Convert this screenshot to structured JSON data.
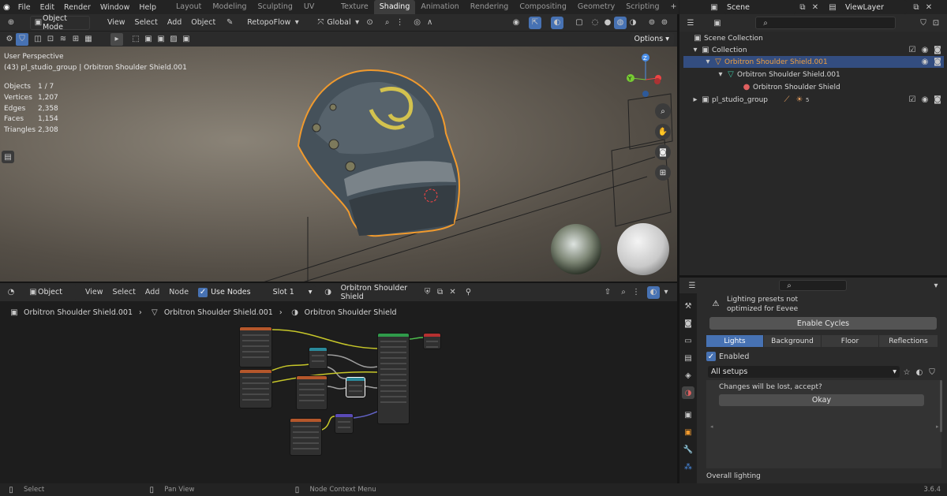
{
  "menu": [
    "File",
    "Edit",
    "Render",
    "Window",
    "Help"
  ],
  "workspaces": [
    "Layout",
    "Modeling",
    "Sculpting",
    "UV Editing",
    "Texture Paint",
    "Shading",
    "Animation",
    "Rendering",
    "Compositing",
    "Geometry Nodes",
    "Scripting"
  ],
  "active_workspace": "Shading",
  "scene": {
    "label": "Scene",
    "view_layer": "ViewLayer"
  },
  "viewport": {
    "mode": "Object Mode",
    "menus": [
      "View",
      "Select",
      "Add",
      "Object"
    ],
    "addon": "RetopoFlow",
    "orientation": "Global",
    "options": "Options",
    "perspective": "User Perspective",
    "context": "(43) pl_studio_group | Orbitron Shoulder Shield.001",
    "stats": [
      {
        "label": "Objects",
        "value": "1 / 7"
      },
      {
        "label": "Vertices",
        "value": "1,207"
      },
      {
        "label": "Edges",
        "value": "2,358"
      },
      {
        "label": "Faces",
        "value": "1,154"
      },
      {
        "label": "Triangles",
        "value": "2,308"
      }
    ],
    "gizmo": {
      "z": "Z",
      "y": "Y"
    }
  },
  "outliner": {
    "rows": [
      {
        "label": "Scene Collection"
      },
      {
        "label": "Collection"
      },
      {
        "label": "Orbitron Shoulder Shield.001"
      },
      {
        "label": "Orbitron Shoulder Shield.001"
      },
      {
        "label": "Orbitron Shoulder Shield"
      },
      {
        "label": "pl_studio_group",
        "badge": "5"
      }
    ]
  },
  "node_editor": {
    "type": "Object",
    "menus": [
      "View",
      "Select",
      "Add",
      "Node"
    ],
    "use_nodes": "Use Nodes",
    "slot": "Slot 1",
    "material": "Orbitron Shoulder Shield",
    "breadcrumb": [
      "Orbitron Shoulder Shield.001",
      "Orbitron Shoulder Shield.001",
      "Orbitron Shoulder Shield"
    ]
  },
  "properties": {
    "warning_line1": "Lighting presets not",
    "warning_line2": "optimized for Eevee",
    "enable_cycles": "Enable Cycles",
    "tabs": [
      "Lights",
      "Background",
      "Floor",
      "Reflections"
    ],
    "enabled": "Enabled",
    "setups": "All setups",
    "confirm": "Changes will be lost, accept?",
    "okay": "Okay",
    "section": "Overall lighting"
  },
  "status": {
    "select": "Select",
    "pan": "Pan View",
    "context": "Node Context Menu",
    "version": "3.6.4"
  },
  "colors": {
    "accent": "#4772b3",
    "selection_outline": "#f09a2e",
    "selected_row": "#334d80"
  }
}
